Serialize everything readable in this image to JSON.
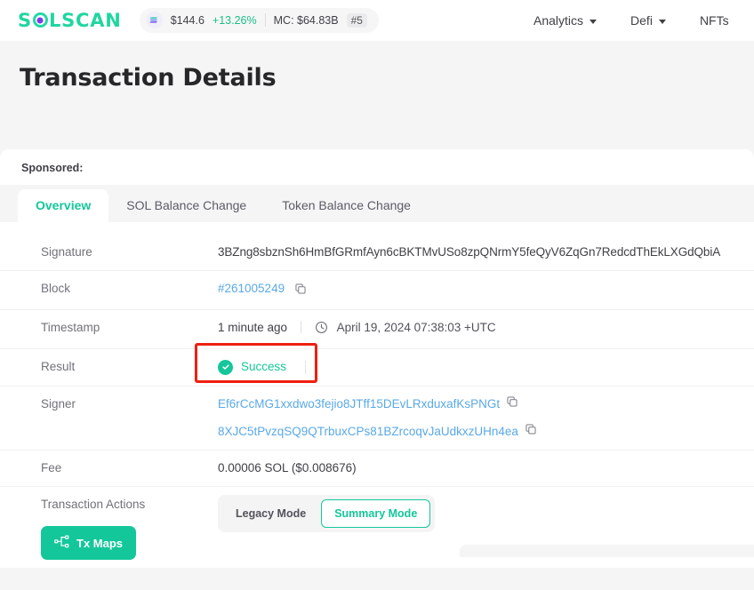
{
  "header": {
    "logo_text_1": "S",
    "logo_o": "O",
    "logo_text_2": "LSCAN",
    "logo_icon": "solscan-logo",
    "ticker": {
      "coin_icon": "solana-icon",
      "price": "$144.6",
      "change": "+13.26%",
      "market_cap": "MC: $64.83B",
      "rank": "#5"
    },
    "nav": [
      {
        "label": "Analytics",
        "has_dropdown": true
      },
      {
        "label": "Defi",
        "has_dropdown": true
      },
      {
        "label": "NFTs",
        "has_dropdown": false
      }
    ]
  },
  "page": {
    "title": "Transaction Details",
    "sponsored_label": "Sponsored:"
  },
  "tabs": [
    {
      "label": "Overview",
      "active": true
    },
    {
      "label": "SOL Balance Change",
      "active": false
    },
    {
      "label": "Token Balance Change",
      "active": false
    }
  ],
  "details": {
    "signature": {
      "label": "Signature",
      "value": "3BZng8sbznSh6HmBfGRmfAyn6cBKTMvUSo8zpQNrmY5feQyV6ZqGn7RedcdThEkLXGdQbiA"
    },
    "block": {
      "label": "Block",
      "value": "#261005249",
      "copy_icon": "copy-icon"
    },
    "timestamp": {
      "label": "Timestamp",
      "relative": "1 minute ago",
      "clock_icon": "clock-icon",
      "absolute": "April 19, 2024 07:38:03 +UTC"
    },
    "result": {
      "label": "Result",
      "status": "Success",
      "status_icon": "check-circle-icon",
      "annotation": "red-highlight-box"
    },
    "signer": {
      "label": "Signer",
      "addresses": [
        "Ef6rCcMG1xxdwo3fejio8JTff15DEvLRxduxafKsPNGt",
        "8XJC5tPvzqSQ9QTrbuxCPs81BZrcoqvJaUdkxzUHn4ea"
      ]
    },
    "fee": {
      "label": "Fee",
      "value": "0.00006 SOL ($0.008676)"
    },
    "transaction_actions": {
      "label": "Transaction Actions",
      "tx_maps_button": "Tx Maps",
      "tx_maps_icon": "tx-map-graph-icon",
      "modes": [
        {
          "label": "Legacy Mode",
          "active": false
        },
        {
          "label": "Summary Mode",
          "active": true
        }
      ]
    }
  },
  "colors": {
    "brand_teal": "#14c79a",
    "link_blue": "#5aa9e6",
    "annotation_red": "#f01f0f",
    "page_bg": "#f5f5f6",
    "text_muted": "#71717a"
  }
}
